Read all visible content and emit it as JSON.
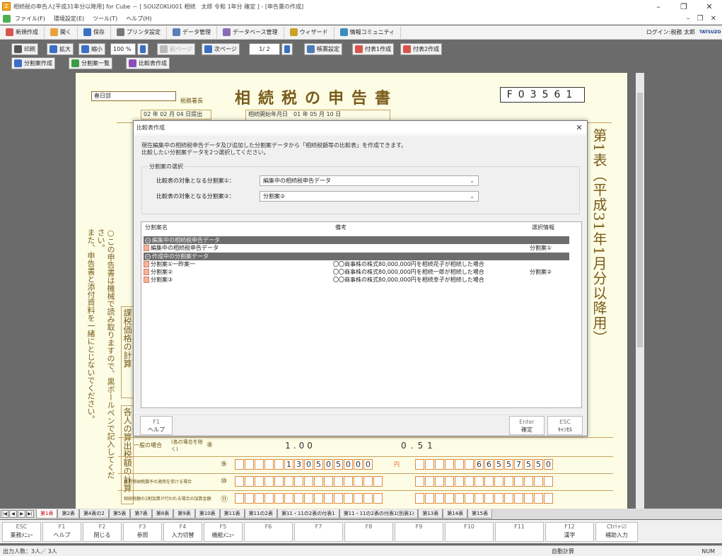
{
  "window": {
    "title": "相続税の申告人[平成31年分以降用] for Cube － [ SOUZOKU001 相続　太郎 令和 1年分 確定 ] - [申告書の作成]",
    "app_icon": "Z"
  },
  "menu": [
    "ファイル(F)",
    "環境設定(E)",
    "ツール(T)",
    "ヘルプ(H)"
  ],
  "toolbar1": {
    "buttons": [
      "新規作成",
      "開く",
      "保存",
      "プリンタ設定",
      "データ管理",
      "データベース管理",
      "ウィザード",
      "情報コミュニティ"
    ],
    "user": "ログイン:税務 太郎",
    "logo": "TATSUZO"
  },
  "toolbar2": {
    "print": "印刷",
    "zoom_in": "拡大",
    "zoom_out": "縮小",
    "zoom": "100 %",
    "prev_page": "前ページ",
    "next_page": "次ページ",
    "page": "1/ 2",
    "form_settings": "帳票設定",
    "attach_table1": "付表1作成",
    "attach_table2": "付表2作成"
  },
  "toolbar3": {
    "split_create": "分割案作成",
    "split_list": "分割案一覧",
    "compare_create": "比較表作成"
  },
  "document": {
    "office": "春日部",
    "office_suffix": "税務署長",
    "title": "相続税の申告書",
    "form_code": "F03561",
    "date_submitted": "02 年 02 月 04 日提出",
    "inheritance_start": "相続開始年月日　01 年 05 月 10 日",
    "side_title": "第1表（平成31年1月分以降用）",
    "left_note": "○この申告書は機械で読み取りますので、黒ボールペンで記入してください。",
    "left_note2": "また、申告書と添付資料を一緒にとじないでください。",
    "section_tax": "課税価格の計算",
    "section_calc": "各人の算出税額の計算",
    "rows": [
      {
        "label": "一般の場合",
        "sub": "(各の場合を除く)",
        "no": "⑧",
        "left": "1.00",
        "right": "0.51"
      },
      {
        "label": "",
        "sub": "",
        "no": "⑨",
        "left": "130505000",
        "right": "66557550"
      },
      {
        "label": "農地等納税猶予の適用を受ける場合",
        "sub": "",
        "no": "⑩",
        "left": "",
        "right": ""
      },
      {
        "label": "相続税額の2割加算が行われる場合の加算金額",
        "sub": "",
        "no": "⑪",
        "left": "",
        "right": ""
      }
    ],
    "yen": "円"
  },
  "dialog": {
    "title": "比較表作成",
    "description": "現在編集中の相続税申告データ及び追加した分割案データから「相続税額等の比較表」を作成できます。\n比較したい分割案データを2つ選択してください。",
    "group_title": "分割案の選択",
    "select1_label": "比較表の対象となる分割案①：",
    "select1_value": "編集中の相続税申告データ",
    "select2_label": "比較表の対象となる分割案②：",
    "select2_value": "分割案②",
    "list_headers": [
      "分割案名",
      "備考",
      "選択情報"
    ],
    "groups": [
      {
        "name": "編集中の相続税申告データ",
        "items": [
          {
            "name": "編集中の相続税申告データ",
            "note": "",
            "sel": "分割案①"
          }
        ]
      },
      {
        "name": "作成中の分割案データ",
        "items": [
          {
            "name": "分割案①一昨案一",
            "note": "〇〇商事株の株式80,000,000円を相続花子が相続した場合",
            "sel": ""
          },
          {
            "name": "分割案②",
            "note": "〇〇商事株の株式80,000,000円を相続一郎が相続した場合",
            "sel": "分割案②"
          },
          {
            "name": "分割案③",
            "note": "〇〇商事株の株式80,000,000円を相続幸子が相続した場合",
            "sel": ""
          }
        ]
      }
    ],
    "footer": {
      "help_key": "F1",
      "help_label": "ヘルプ",
      "ok_key": "Enter",
      "ok_label": "確定",
      "cancel_key": "ESC",
      "cancel_label": "ｷｬﾝｾﾙ"
    }
  },
  "sheet_tabs": [
    "第1表",
    "第2表",
    "第4表の2",
    "第5表",
    "第7表",
    "第8表",
    "第9表",
    "第10表",
    "第11表",
    "第11の2表",
    "第11・11の2表の付表1",
    "第11・11の2表の付表1(別表1)",
    "第13表",
    "第14表",
    "第15表"
  ],
  "fkeys": [
    {
      "key": "ESC",
      "label": "業務ﾒﾆｭｰ"
    },
    {
      "key": "F1",
      "label": "ヘルプ"
    },
    {
      "key": "F2",
      "label": "閉じる"
    },
    {
      "key": "F3",
      "label": "参照"
    },
    {
      "key": "F4",
      "label": "入力切替"
    },
    {
      "key": "F5",
      "label": "機能ﾒﾆｭｰ"
    },
    {
      "key": "F6",
      "label": ""
    },
    {
      "key": "F7",
      "label": ""
    },
    {
      "key": "F8",
      "label": ""
    },
    {
      "key": "F9",
      "label": ""
    },
    {
      "key": "F10",
      "label": ""
    },
    {
      "key": "F11",
      "label": ""
    },
    {
      "key": "F12",
      "label": "漢字"
    },
    {
      "key": "Ctrl+☑",
      "label": "補助入力"
    }
  ],
  "status": {
    "people": "出力人数：3人／ 3人",
    "auto": "自動計算",
    "num": "NUM"
  }
}
